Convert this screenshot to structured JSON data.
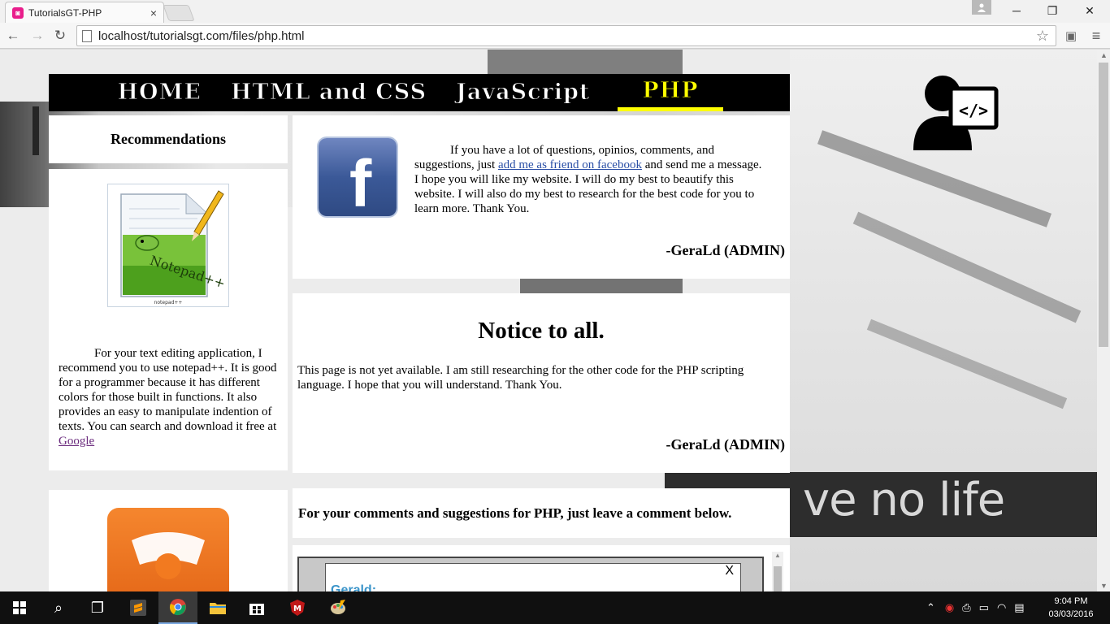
{
  "browser": {
    "tab_title": "TutorialsGT-PHP",
    "tab_close": "×",
    "url": "localhost/tutorialsgt.com/files/php.html",
    "win_minimize": "─",
    "win_maximize": "❐",
    "win_close": "✕"
  },
  "nav": {
    "items": [
      {
        "label": "HOME"
      },
      {
        "label": "HTML and CSS"
      },
      {
        "label": "JavaScript"
      },
      {
        "label": "PHP"
      }
    ],
    "active": "PHP"
  },
  "sidebar": {
    "title": "Recommendations",
    "notepad": {
      "img_caption": "notepad++",
      "text": "For your text editing application, I recommend you to use notepad++. It is good for a programmer because it has different colors for those built in functions. It also provides an easy to manipulate indention of texts. You can search and download it free at ",
      "link": "Google"
    }
  },
  "facebook_panel": {
    "text_before": "If you have a lot of questions, opinios, comments, and suggestions, just ",
    "link": "add me as friend on facebook",
    "text_after": " and send me a message. I hope you will like my website. I will do my best to beautify this website. I will also do my best to research for the best code for you to learn more. Thank You.",
    "signature": "-GeraLd (ADMIN)"
  },
  "notice_panel": {
    "title": "Notice to all.",
    "text": "This page is not yet available. I am still researching for the other code for the PHP scripting language. I hope that you will understand. Thank You.",
    "signature": "-GeraLd (ADMIN)"
  },
  "comment_prompt": "For your comments and suggestions for PHP, just leave a comment below.",
  "comment_box": {
    "name": "Gerald:",
    "close": "X"
  },
  "background_text": "ve no life",
  "taskbar": {
    "time": "9:04 PM",
    "date": "03/03/2016"
  },
  "colors": {
    "nav_bg": "#000000",
    "nav_active": "#ffff00",
    "link": "#2a4fa6",
    "comment_name": "#3a94c9"
  }
}
